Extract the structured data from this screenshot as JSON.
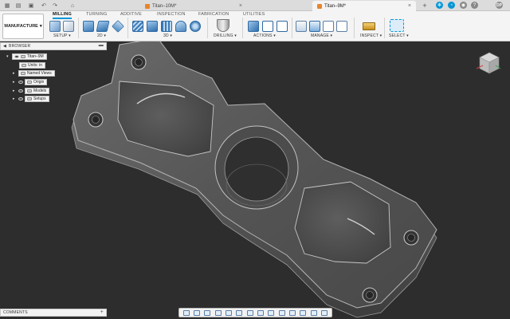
{
  "colors": {
    "accent": "#0696d7",
    "doc_icon": "#e8842c",
    "viewport_bg": "#2d2d2d",
    "ribbon_bg": "#f4f4f4"
  },
  "titlebar": {
    "left_icons": [
      "app-grid-icon",
      "file-icon",
      "save-icon",
      "undo-icon",
      "redo-icon",
      "home-icon"
    ],
    "tabs": [
      {
        "label": "Titan–10M*",
        "active": false
      },
      {
        "label": "Titan–9M*",
        "active": true
      }
    ],
    "right_icons": [
      "new-tab-icon",
      "extensions-icon",
      "job-status-icon",
      "notifications-icon",
      "help-icon"
    ],
    "avatar_initials": "DP"
  },
  "workspace": {
    "label": "MANUFACTURE"
  },
  "ribbon_tabs": [
    {
      "label": "MILLING",
      "active": true
    },
    {
      "label": "TURNING",
      "active": false
    },
    {
      "label": "ADDITIVE",
      "active": false
    },
    {
      "label": "INSPECTION",
      "active": false
    },
    {
      "label": "FABRICATION",
      "active": false
    },
    {
      "label": "UTILITIES",
      "active": false
    }
  ],
  "tool_groups": [
    {
      "label": "SETUP"
    },
    {
      "label": "2D"
    },
    {
      "label": "3D"
    },
    {
      "label": "DRILLING"
    },
    {
      "label": "ACTIONS"
    },
    {
      "label": "MANAGE"
    },
    {
      "label": "INSPECT"
    },
    {
      "label": "SELECT"
    }
  ],
  "browser": {
    "title": "BROWSER",
    "root": "Titan–9M",
    "units": "Units: in",
    "nodes": [
      "Named Views",
      "Origin",
      "Models",
      "Setups"
    ]
  },
  "comments": {
    "label": "COMMENTS"
  },
  "nav_tools": [
    "orbit-icon",
    "look-at-icon",
    "pan-icon",
    "zoom-icon",
    "fit-icon",
    "display-settings-icon",
    "grid-icon",
    "viewports-icon",
    "section-icon",
    "camera-icon",
    "visual-style-icon",
    "effects-icon",
    "object-visibility-icon",
    "selection-filter-icon"
  ]
}
